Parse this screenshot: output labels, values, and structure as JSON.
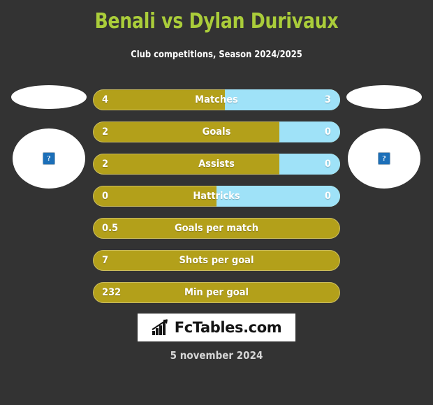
{
  "header": {
    "title": "Benali vs Dylan Durivaux",
    "subtitle": "Club competitions, Season 2024/2025",
    "title_color": "#aacd3a",
    "subtitle_color": "#ffffff"
  },
  "theme": {
    "background": "#333333",
    "home_bar_color": "#b3a01a",
    "away_bar_color": "#9fe2f8",
    "value_text_color": "#ffffff"
  },
  "players": {
    "home": {
      "avatar_icon": "broken-image-icon",
      "avatar_placeholder": "?"
    },
    "away": {
      "avatar_icon": "broken-image-icon",
      "avatar_placeholder": "?"
    }
  },
  "chart_data": {
    "type": "bar",
    "title": "Benali vs Dylan Durivaux",
    "subtitle": "Club competitions, Season 2024/2025",
    "orientation": "horizontal-diverging",
    "series": [
      {
        "name": "Benali",
        "color": "#b3a01a"
      },
      {
        "name": "Dylan Durivaux",
        "color": "#9fe2f8"
      }
    ],
    "categories": [
      "Matches",
      "Goals",
      "Assists",
      "Hattricks",
      "Goals per match",
      "Shots per goal",
      "Min per goal"
    ],
    "rows": [
      {
        "label": "Matches",
        "home": "4",
        "away": "3",
        "home_pct": 53.5,
        "has_away": true
      },
      {
        "label": "Goals",
        "home": "2",
        "away": "0",
        "home_pct": 75.5,
        "has_away": true
      },
      {
        "label": "Assists",
        "home": "2",
        "away": "0",
        "home_pct": 75.5,
        "has_away": true
      },
      {
        "label": "Hattricks",
        "home": "0",
        "away": "0",
        "home_pct": 50.0,
        "has_away": true
      },
      {
        "label": "Goals per match",
        "home": "0.5",
        "away": "",
        "home_pct": 100,
        "has_away": false
      },
      {
        "label": "Shots per goal",
        "home": "7",
        "away": "",
        "home_pct": 100,
        "has_away": false
      },
      {
        "label": "Min per goal",
        "home": "232",
        "away": "",
        "home_pct": 100,
        "has_away": false
      }
    ]
  },
  "footer": {
    "logo_icon": "bar-chart-growth-icon",
    "logo_text": "FcTables.com",
    "date": "5 november 2024"
  }
}
